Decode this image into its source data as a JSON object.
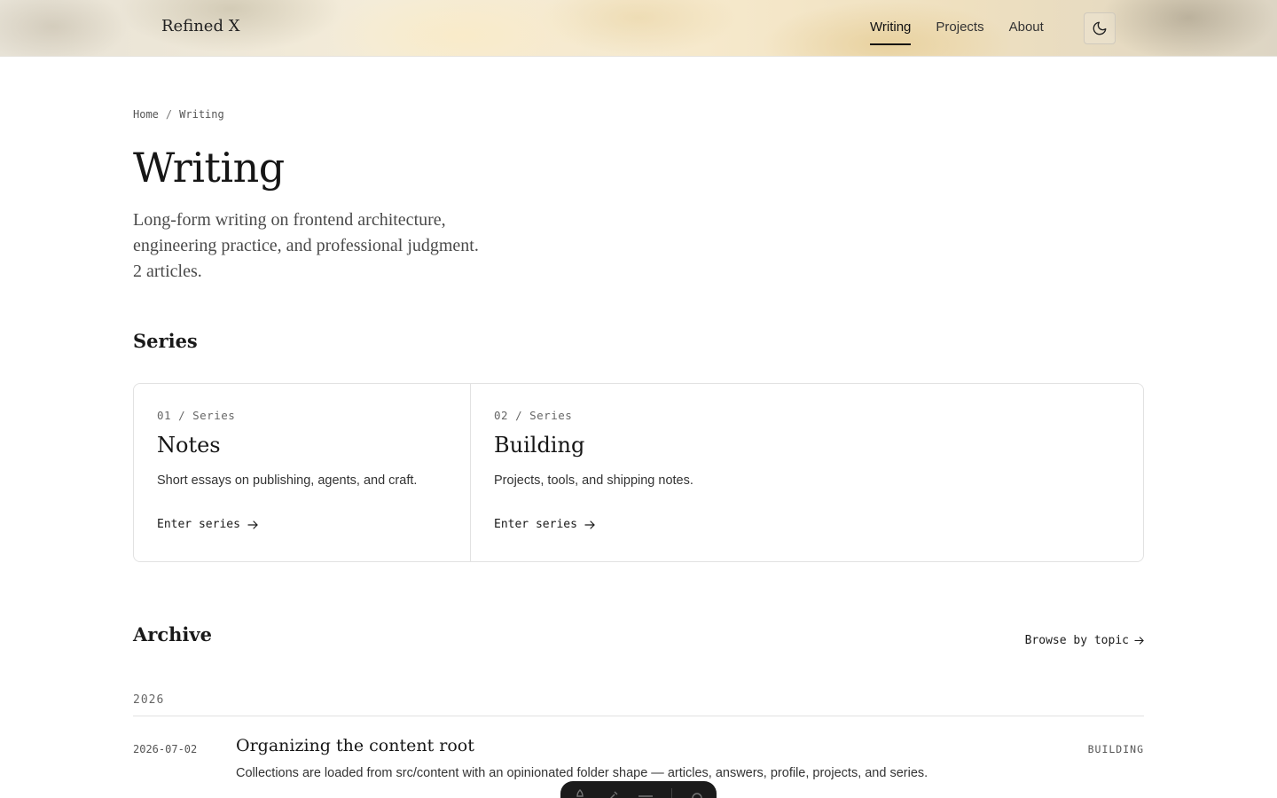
{
  "header": {
    "brand": "Refined X",
    "nav": [
      {
        "label": "Writing",
        "active": true
      },
      {
        "label": "Projects",
        "active": false
      },
      {
        "label": "About",
        "active": false
      }
    ],
    "theme_toggle_icon": "moon-icon"
  },
  "breadcrumb": {
    "items": [
      "Home",
      "Writing"
    ],
    "separator": "/"
  },
  "page": {
    "title": "Writing",
    "lede": "Long-form writing on frontend architecture, engineering practice, and professional judgment. 2 articles."
  },
  "series": {
    "heading": "Series",
    "items": [
      {
        "number": "01 / Series",
        "name": "Notes",
        "description": "Short essays on publishing, agents, and craft.",
        "link_label": "Enter series"
      },
      {
        "number": "02 / Series",
        "name": "Building",
        "description": "Projects, tools, and shipping notes.",
        "link_label": "Enter series"
      }
    ]
  },
  "archive": {
    "heading": "Archive",
    "browse_label": "Browse by topic",
    "years": [
      {
        "year": "2026",
        "articles": [
          {
            "date": "2026-07-02",
            "title": "Organizing the content root",
            "tag": "BUILDING",
            "excerpt": "Collections are loaded from src/content with an opinionated folder shape — articles, answers, profile, projects, and series."
          }
        ]
      }
    ]
  },
  "dock": {
    "icons": [
      "pen-icon",
      "brush-icon",
      "menu-icon",
      "settings-icon"
    ]
  },
  "colors": {
    "text": "#1a1a1a",
    "muted": "#555555",
    "border": "#e2e2e2",
    "dock": "#1b1b1b"
  }
}
